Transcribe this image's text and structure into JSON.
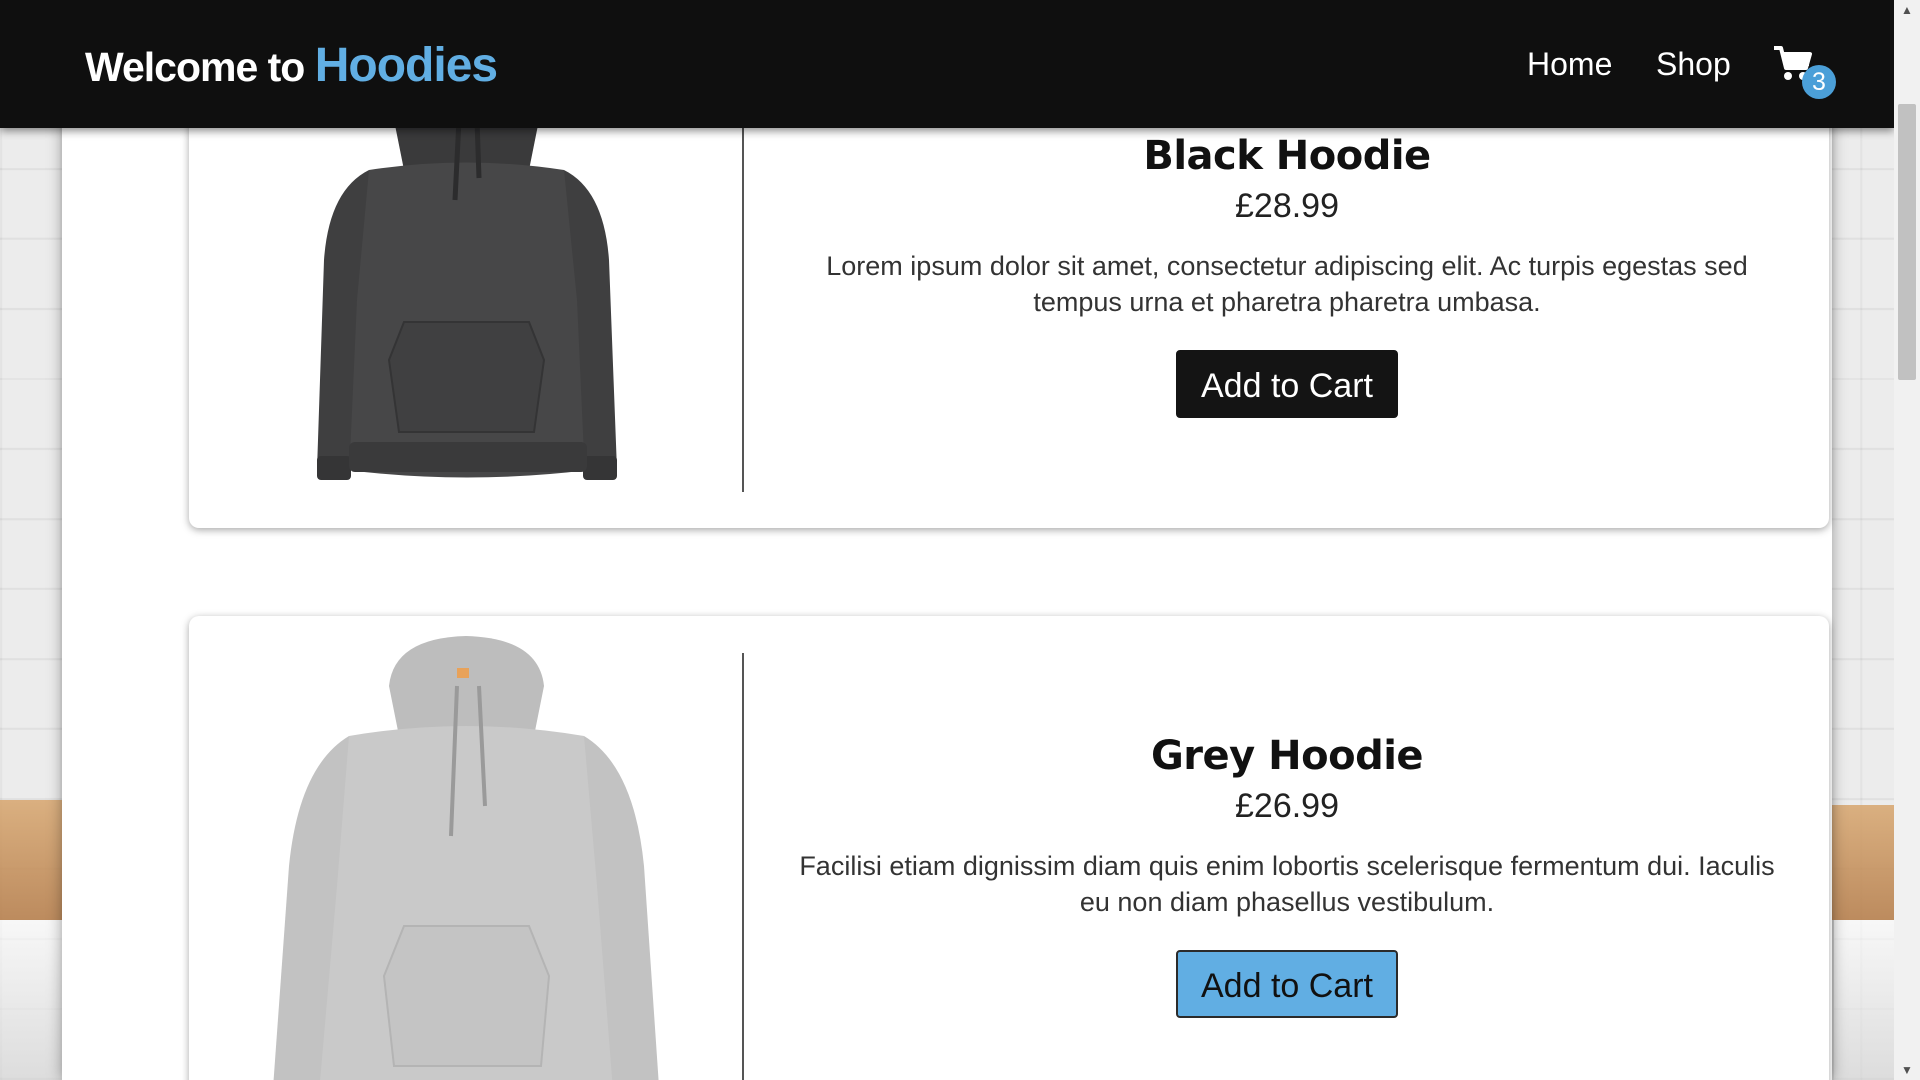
{
  "navbar": {
    "brand_prefix": "Welcome to ",
    "brand_name": "Hoodies",
    "links": [
      {
        "label": "Home"
      },
      {
        "label": "Shop"
      }
    ],
    "cart_icon": "shopping-cart-icon",
    "cart_count": "3"
  },
  "products": [
    {
      "name": "Black Hoodie",
      "price": "£28.99",
      "description": "Lorem ipsum dolor sit amet, consectetur adipiscing elit. Ac turpis egestas sed tempus urna et pharetra pharetra umbasa.",
      "button_label": "Add to Cart",
      "image_icon": "black-hoodie-image"
    },
    {
      "name": "Grey Hoodie",
      "price": "£26.99",
      "description": "Facilisi etiam dignissim diam quis enim lobortis scelerisque fermentum dui. Iaculis eu non diam phasellus vestibulum.",
      "button_label": "Add to Cart",
      "image_icon": "grey-hoodie-image"
    }
  ],
  "colors": {
    "navbar_bg": "#0f0f0f",
    "accent": "#61aee3",
    "badge": "#4b9fd8",
    "primary_button": "#141414"
  }
}
